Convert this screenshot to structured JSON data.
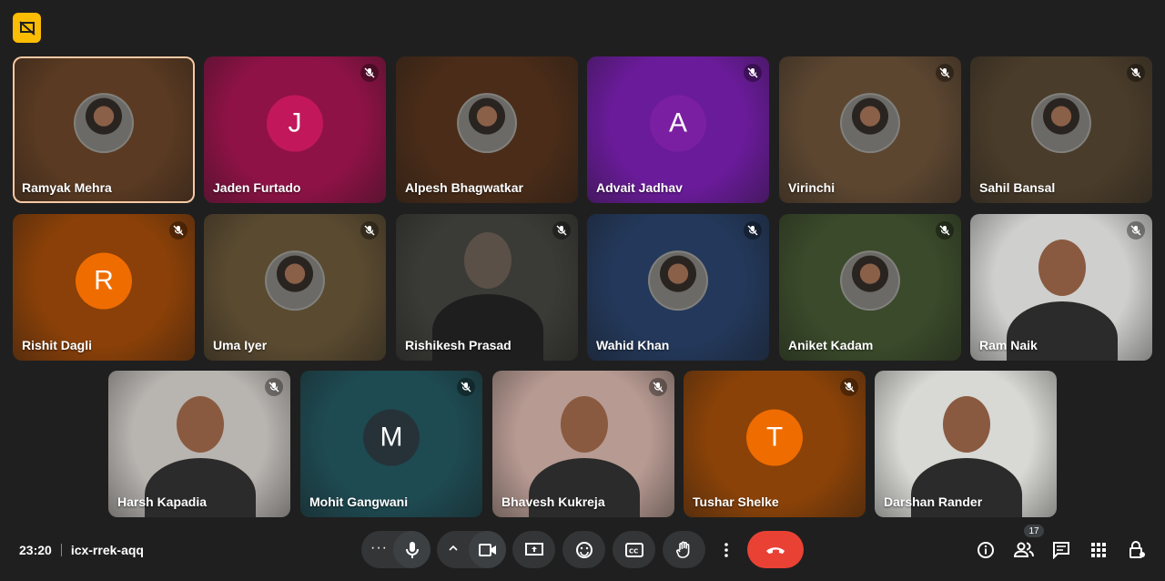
{
  "meeting": {
    "time": "23:20",
    "code": "icx-rrek-aqq",
    "participant_count": "17"
  },
  "participants": [
    {
      "name": "Ramyak Mehra",
      "type": "photo",
      "bg": "#5a3a22",
      "muted": false,
      "active": true
    },
    {
      "name": "Jaden Furtado",
      "type": "initial",
      "initial": "J",
      "bg": "#8e1246",
      "avatar": "#c2185b",
      "muted": true
    },
    {
      "name": "Alpesh Bhagwatkar",
      "type": "photo",
      "bg": "#4a2c18",
      "muted": false
    },
    {
      "name": "Advait Jadhav",
      "type": "initial",
      "initial": "A",
      "bg": "#6a1b9a",
      "avatar": "#7b1fa2",
      "muted": true
    },
    {
      "name": "Virinchi",
      "type": "photo",
      "bg": "#5c4630",
      "muted": true
    },
    {
      "name": "Sahil Bansal",
      "type": "photo",
      "bg": "#4a3c2a",
      "muted": true
    },
    {
      "name": "Rishit Dagli",
      "type": "initial",
      "initial": "R",
      "bg": "#8a4008",
      "avatar": "#ef6c00",
      "muted": true
    },
    {
      "name": "Uma Iyer",
      "type": "photo",
      "bg": "#5a4a30",
      "muted": true
    },
    {
      "name": "Rishikesh Prasad",
      "type": "video",
      "bg": "#3a3a36",
      "muted": true
    },
    {
      "name": "Wahid Khan",
      "type": "photo",
      "bg": "#23385a",
      "muted": true
    },
    {
      "name": "Aniket Kadam",
      "type": "photo",
      "bg": "#3a4a2a",
      "muted": true
    },
    {
      "name": "Ram Naik",
      "type": "video",
      "bg": "#cfcfcd",
      "muted": true
    },
    {
      "name": "Harsh Kapadia",
      "type": "video",
      "bg": "#b8b4b0",
      "muted": true
    },
    {
      "name": "Mohit Gangwani",
      "type": "initial",
      "initial": "M",
      "bg": "#1e4a52",
      "avatar": "#263238",
      "muted": true
    },
    {
      "name": "Bhavesh Kukreja",
      "type": "video",
      "bg": "#b79a92",
      "muted": true
    },
    {
      "name": "Tushar Shelke",
      "type": "initial",
      "initial": "T",
      "bg": "#8a4208",
      "avatar": "#ef6c00",
      "muted": true
    },
    {
      "name": "Darshan Rander",
      "type": "video",
      "bg": "#d8d8d4",
      "muted": false
    }
  ],
  "colors": {
    "end_call": "#e94235",
    "badge": "#fbbc04",
    "control_bg": "#333537"
  }
}
